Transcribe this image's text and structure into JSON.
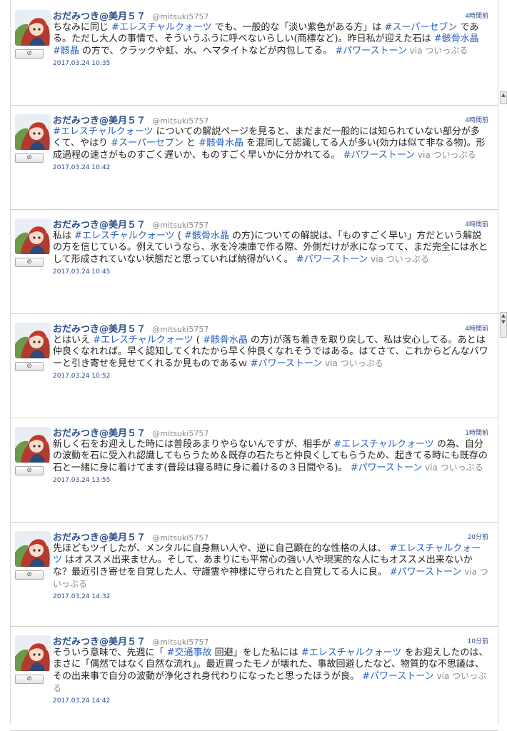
{
  "tweets": [
    {
      "name": "おだみつき@美月５７",
      "handle": "@mitsuki5757",
      "time": "4時間前",
      "date": "2017.03.24 10:35",
      "parts": [
        {
          "t": "ちなみに同じ "
        },
        {
          "t": "#エレスチャルクォーツ",
          "tag": true
        },
        {
          "t": " でも、一般的な「淡い紫色がある方」は "
        },
        {
          "t": "#スーパーセブン",
          "tag": true
        },
        {
          "t": " である。ただし大人の事情で、そういうふうに呼べないらしい(商標など)。昨日私が迎えた石は "
        },
        {
          "t": "#骸骨水晶",
          "tag": true
        },
        {
          "t": " "
        },
        {
          "t": "#骸晶",
          "tag": true
        },
        {
          "t": " の方で、クラックや虹、水、ヘマタイトなどが内包してる。 "
        },
        {
          "t": "#パワーストーン",
          "tag": true
        },
        {
          "t": " via ついっぷる",
          "via": true
        }
      ]
    },
    {
      "name": "おだみつき@美月５７",
      "handle": "@mitsuki5757",
      "time": "4時間前",
      "date": "2017.03.24 10:42",
      "parts": [
        {
          "t": "#エレスチャルクォーツ",
          "tag": true
        },
        {
          "t": " についての解説ページを見ると、まだまだ一般的には知られていない部分が多くて、やはり "
        },
        {
          "t": "#スーパーセブン",
          "tag": true
        },
        {
          "t": " と "
        },
        {
          "t": "#骸骨水晶",
          "tag": true
        },
        {
          "t": " を混同して認識してる人が多い(効力は似て非なる物)。形成過程の速さがものすごく遅いか、ものすごく早いかに分かれてる。 "
        },
        {
          "t": "#パワーストーン",
          "tag": true
        },
        {
          "t": " via ついっぷる",
          "via": true
        }
      ]
    },
    {
      "name": "おだみつき@美月５７",
      "handle": "@mitsuki5757",
      "time": "4時間前",
      "date": "2017.03.24 10:45",
      "parts": [
        {
          "t": "私は "
        },
        {
          "t": "#エレスチャルクォーツ",
          "tag": true
        },
        {
          "t": " ( "
        },
        {
          "t": "#骸骨水晶",
          "tag": true
        },
        {
          "t": " の方)についての解説は、「ものすごく早い」方だという解説の方を信じている。例えていうなら、氷を冷凍庫で作る際、外側だけが氷になってて、まだ完全には氷として形成されていない状態だと思っていれば納得がいく。 "
        },
        {
          "t": "#パワーストーン",
          "tag": true
        },
        {
          "t": " via ついっぷる",
          "via": true
        }
      ]
    },
    {
      "name": "おだみつき@美月５７",
      "handle": "@mitsuki5757",
      "time": "4時間前",
      "date": "2017.03.24 10:52",
      "parts": [
        {
          "t": "とはいえ "
        },
        {
          "t": "#エレスチャルクォーツ",
          "tag": true
        },
        {
          "t": " ( "
        },
        {
          "t": "#骸骨水晶",
          "tag": true
        },
        {
          "t": " の方)が落ち着きを取り戻して、私は安心してる。あとは仲良くなれれば。早く認知してくれたから早く仲良くなれそうではある。はてさて、これからどんなパワーと引き寄せを見せてくれるか見ものであるｗ "
        },
        {
          "t": "#パワーストーン",
          "tag": true
        },
        {
          "t": " via ついっぷる",
          "via": true
        }
      ]
    },
    {
      "name": "おだみつき@美月５７",
      "handle": "@mitsuki5757",
      "time": "1時間前",
      "date": "2017.03.24 13:55",
      "parts": [
        {
          "t": "新しく石をお迎えした時には普段あまりやらないんですが、相手が "
        },
        {
          "t": "#エレスチャルクォーツ",
          "tag": true
        },
        {
          "t": " の為、自分の波動を石に受入れ認識してもらうため＆既存の石たちと仲良くしてもらうため、起きてる時にも既存の石と一緒に身に着けてます(普段は寝る時に身に着けるの３日間やる)。 "
        },
        {
          "t": "#パワーストーン",
          "tag": true
        },
        {
          "t": " via ついっぷる",
          "via": true
        }
      ]
    },
    {
      "name": "おだみつき@美月５７",
      "handle": "@mitsuki5757",
      "time": "20分前",
      "date": "2017.03.24 14:32",
      "parts": [
        {
          "t": "先ほどもツイしたが、メンタルに自身無い人や、逆に自己顕在的な性格の人は、 "
        },
        {
          "t": "#エレスチャルクォーツ",
          "tag": true
        },
        {
          "t": " はオススメ出来ません。そして、あまりにも平常心の強い人や現実的な人にもオススメ出来ないかな？最近引き寄せを自覚した人、守護霊や神様に守られたと自覚してる人に良。 "
        },
        {
          "t": "#パワーストーン",
          "tag": true
        },
        {
          "t": " via ついっぷる",
          "via": true
        }
      ]
    },
    {
      "name": "おだみつき@美月５７",
      "handle": "@mitsuki5757",
      "time": "10分前",
      "date": "2017.03.24 14:42",
      "parts": [
        {
          "t": "そういう意味で、先週に「 "
        },
        {
          "t": "#交通事故",
          "tag": true
        },
        {
          "t": " 回避」をした私には "
        },
        {
          "t": "#エレスチャルクォーツ",
          "tag": true
        },
        {
          "t": " をお迎えしたのは、まさに「偶然ではなく自然な流れ」。最近買ったモノが壊れた、事故回避したなど、物質的な不思議は、その出来事で自分の波動が浄化され身代わりになったと思ったほうが良。 "
        },
        {
          "t": "#パワーストーン",
          "tag": true
        },
        {
          "t": " via ついっぷる",
          "via": true
        }
      ]
    }
  ],
  "block_button_label": "⊘",
  "icons": {
    "avatar": "avatar-image",
    "block": "block-icon",
    "scroll": "scroll-arrow-icon"
  },
  "colors": {
    "name": "#2d4e8c",
    "hashtag": "#2a62c1",
    "via": "#8a8a8a",
    "time": "#2d4e8c"
  }
}
